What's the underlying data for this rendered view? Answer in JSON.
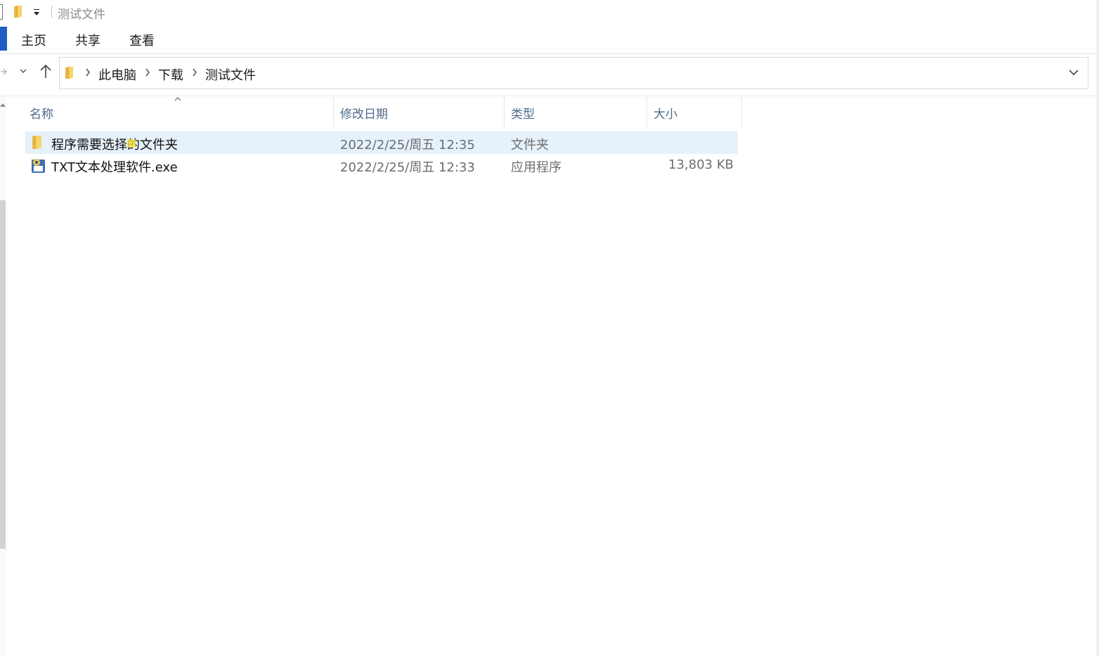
{
  "window": {
    "title": "测试文件",
    "quick_access": {
      "folder_icon": "folder-icon",
      "dropdown_icon": "customize-dropdown-icon"
    }
  },
  "ribbon": {
    "tabs": [
      {
        "label": "主页"
      },
      {
        "label": "共享"
      },
      {
        "label": "查看"
      }
    ],
    "accent_color": "#1f5fbf"
  },
  "address_bar": {
    "breadcrumbs": [
      {
        "label": "此电脑"
      },
      {
        "label": "下载"
      },
      {
        "label": "测试文件"
      }
    ]
  },
  "file_list": {
    "columns": [
      {
        "label": "名称",
        "sorted": "ascending"
      },
      {
        "label": "修改日期"
      },
      {
        "label": "类型"
      },
      {
        "label": "大小"
      }
    ],
    "rows": [
      {
        "name": "程序需要选择的文件夹",
        "date": "2022/2/25/周五 12:35",
        "type": "文件夹",
        "size": "",
        "icon": "folder-icon",
        "selected": true
      },
      {
        "name": "TXT文本处理软件.exe",
        "date": "2022/2/25/周五 12:33",
        "type": "应用程序",
        "size": "13,803 KB",
        "icon": "application-icon",
        "selected": false
      }
    ]
  },
  "colors": {
    "selection_bg": "#e5f1fb",
    "header_text": "#4d6a8a",
    "secondary_text": "#6d6d6d"
  }
}
